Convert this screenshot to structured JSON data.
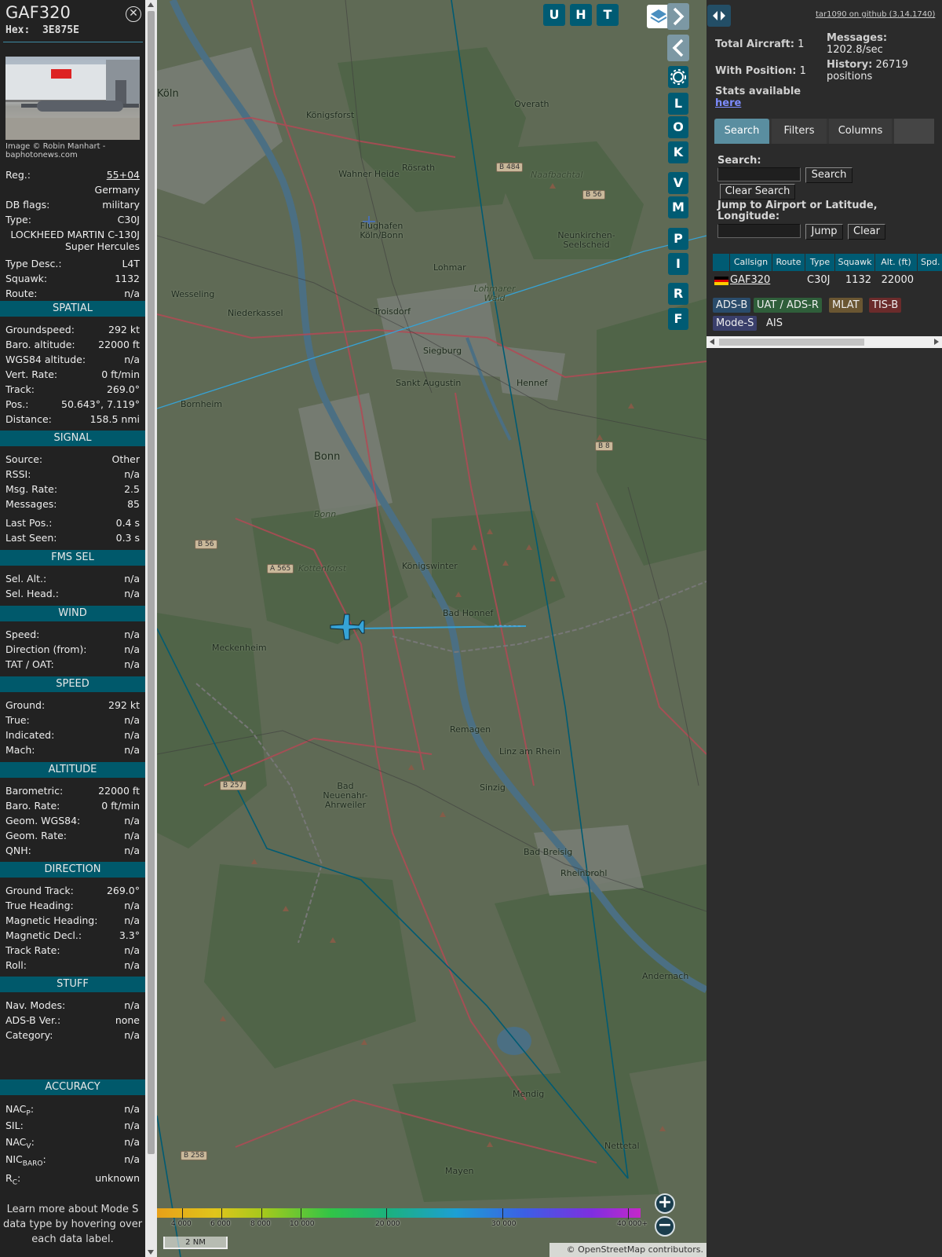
{
  "aircraft": {
    "callsign": "GAF320",
    "hex_label": "Hex:",
    "hex": "3E875E",
    "photo_credit": "Image © Robin Manhart - baphotonews.com"
  },
  "details": {
    "reg_label": "Reg.:",
    "reg": "55+04",
    "country": "Germany",
    "db_flags_label": "DB flags:",
    "db_flags": "military",
    "type_label": "Type:",
    "type": "C30J",
    "type_full": "LOCKHEED MARTIN C-130J Super Hercules",
    "type_desc_label": "Type Desc.:",
    "type_desc": "L4T",
    "squawk_label": "Squawk:",
    "squawk": "1132",
    "route_label": "Route:",
    "route": "n/a"
  },
  "sections": {
    "spatial": "SPATIAL",
    "signal": "SIGNAL",
    "fms_sel": "FMS SEL",
    "wind": "WIND",
    "speed": "SPEED",
    "altitude": "ALTITUDE",
    "direction": "DIRECTION",
    "stuff": "STUFF",
    "accuracy": "ACCURACY"
  },
  "spatial": [
    {
      "label": "Groundspeed:",
      "value": "292 kt"
    },
    {
      "label": "Baro. altitude:",
      "value": "22000 ft"
    },
    {
      "label": "WGS84 altitude:",
      "value": "n/a"
    },
    {
      "label": "Vert. Rate:",
      "value": "0 ft/min"
    },
    {
      "label": "Track:",
      "value": "269.0°"
    },
    {
      "label": "Pos.:",
      "value": "50.643°, 7.119°"
    },
    {
      "label": "Distance:",
      "value": "158.5 nmi"
    }
  ],
  "signal": [
    {
      "label": "Source:",
      "value": "Other"
    },
    {
      "label": "RSSI:",
      "value": "n/a"
    },
    {
      "label": "Msg. Rate:",
      "value": "2.5"
    },
    {
      "label": "Messages:",
      "value": "85"
    },
    {
      "label": "Last Pos.:",
      "value": "0.4 s"
    },
    {
      "label": "Last Seen:",
      "value": "0.3 s"
    }
  ],
  "fms_sel": [
    {
      "label": "Sel. Alt.:",
      "value": "n/a"
    },
    {
      "label": "Sel. Head.:",
      "value": "n/a"
    }
  ],
  "wind": [
    {
      "label": "Speed:",
      "value": "n/a"
    },
    {
      "label": "Direction (from):",
      "value": "n/a"
    },
    {
      "label": "TAT / OAT:",
      "value": "n/a"
    }
  ],
  "speed": [
    {
      "label": "Ground:",
      "value": "292 kt"
    },
    {
      "label": "True:",
      "value": "n/a"
    },
    {
      "label": "Indicated:",
      "value": "n/a"
    },
    {
      "label": "Mach:",
      "value": "n/a"
    }
  ],
  "altitude": [
    {
      "label": "Barometric:",
      "value": "22000 ft"
    },
    {
      "label": "Baro. Rate:",
      "value": "0 ft/min"
    },
    {
      "label": "Geom. WGS84:",
      "value": "n/a"
    },
    {
      "label": "Geom. Rate:",
      "value": "n/a"
    },
    {
      "label": "QNH:",
      "value": "n/a"
    }
  ],
  "direction": [
    {
      "label": "Ground Track:",
      "value": "269.0°"
    },
    {
      "label": "True Heading:",
      "value": "n/a"
    },
    {
      "label": "Magnetic Heading:",
      "value": "n/a"
    },
    {
      "label": "Magnetic Decl.:",
      "value": "3.3°"
    },
    {
      "label": "Track Rate:",
      "value": "n/a"
    },
    {
      "label": "Roll:",
      "value": "n/a"
    }
  ],
  "stuff": [
    {
      "label": "Nav. Modes:",
      "value": "n/a"
    },
    {
      "label": "ADS-B Ver.:",
      "value": "none"
    },
    {
      "label": "Category:",
      "value": "n/a"
    }
  ],
  "accuracy": {
    "nacp_label": "NAC",
    "nacp_sub": "P",
    "nacp": "n/a",
    "sil_label": "SIL:",
    "sil": "n/a",
    "nacv_label": "NAC",
    "nacv_sub": "V",
    "nacv": "n/a",
    "nicbaro_label": "NIC",
    "nicbaro_sub": "BARO",
    "nicbaro": "n/a",
    "rc_label": "R",
    "rc_sub": "C",
    "rc": "unknown"
  },
  "footnote": "Learn more about Mode S data type by hovering over each data label.",
  "map": {
    "buttons": [
      "U",
      "H",
      "T"
    ],
    "side_buttons": [
      "L",
      "O",
      "K",
      "V",
      "M",
      "P",
      "I",
      "R",
      "F"
    ],
    "towns": [
      {
        "name": "Köln",
        "big": true
      },
      {
        "name": "Königsforst"
      },
      {
        "name": "Overath"
      },
      {
        "name": "Rösrath"
      },
      {
        "name": "Wahner Heide"
      },
      {
        "name": "Flughafen Köln/Bonn"
      },
      {
        "name": "Lohmar"
      },
      {
        "name": "Neunkirchen-Seelscheid"
      },
      {
        "name": "Wesseling"
      },
      {
        "name": "Niederkassel"
      },
      {
        "name": "Troisdorf"
      },
      {
        "name": "Siegburg"
      },
      {
        "name": "Sankt Augustin"
      },
      {
        "name": "Hennef"
      },
      {
        "name": "Bornheim"
      },
      {
        "name": "Bonn",
        "big": true
      },
      {
        "name": "Königswinter"
      },
      {
        "name": "Kottenforst"
      },
      {
        "name": "Bad Honnef"
      },
      {
        "name": "Meckenheim"
      },
      {
        "name": "Remagen"
      },
      {
        "name": "Linz am Rhein"
      },
      {
        "name": "Bad Neuenahr-Ahrweiler"
      },
      {
        "name": "Sinzig"
      },
      {
        "name": "Bad Breisig"
      },
      {
        "name": "Rheinbrohl"
      },
      {
        "name": "Andernach"
      },
      {
        "name": "Mendig"
      },
      {
        "name": "Mayen"
      },
      {
        "name": "Nettetal"
      },
      {
        "name": "Lohmarer Wald"
      },
      {
        "name": "Naafbachtal"
      },
      {
        "name": "Bonn"
      }
    ],
    "shields": [
      "B 484",
      "B 56",
      "B 8",
      "B 56",
      "A 565",
      "B 257",
      "B 258"
    ],
    "colorbar_labels": [
      "4 000",
      "6 000",
      "8 000",
      "10 000",
      "20 000",
      "30 000",
      "40 000+"
    ],
    "scale": "2 NM",
    "attribution": "© OpenStreetMap contributors."
  },
  "right": {
    "github": "tar1090 on github (3.14.1740)",
    "total_label": "Total Aircraft:",
    "total": "1",
    "messages_label": "Messages:",
    "messages": "1202.8/sec",
    "with_pos_label": "With Position:",
    "with_pos": "1",
    "history_label": "History:",
    "history": "26719 positions",
    "stats_label": "Stats available",
    "stats_link": "here",
    "tabs": [
      "Search",
      "Filters",
      "Columns"
    ],
    "search_label": "Search:",
    "search_btn": "Search",
    "clear_search_btn": "Clear Search",
    "jump_label": "Jump to Airport or Latitude, Longitude:",
    "jump_btn": "Jump",
    "clear_btn": "Clear",
    "columns": [
      "Callsign",
      "Route",
      "Type",
      "Squawk",
      "Alt. (ft)",
      "Spd."
    ],
    "row": {
      "callsign": "GAF320",
      "type": "C30J",
      "squawk": "1132",
      "alt": "22000"
    },
    "chips": [
      {
        "label": "ADS-B",
        "bg": "#2a4c6b"
      },
      {
        "label": "UAT / ADS-R",
        "bg": "#2f5e3a"
      },
      {
        "label": "MLAT",
        "bg": "#6a5632"
      },
      {
        "label": "TIS-B",
        "bg": "#6b2b2b"
      },
      {
        "label": "Mode-S",
        "bg": "#3a3f6b"
      },
      {
        "label": "AIS",
        "bg": "transparent"
      }
    ]
  }
}
